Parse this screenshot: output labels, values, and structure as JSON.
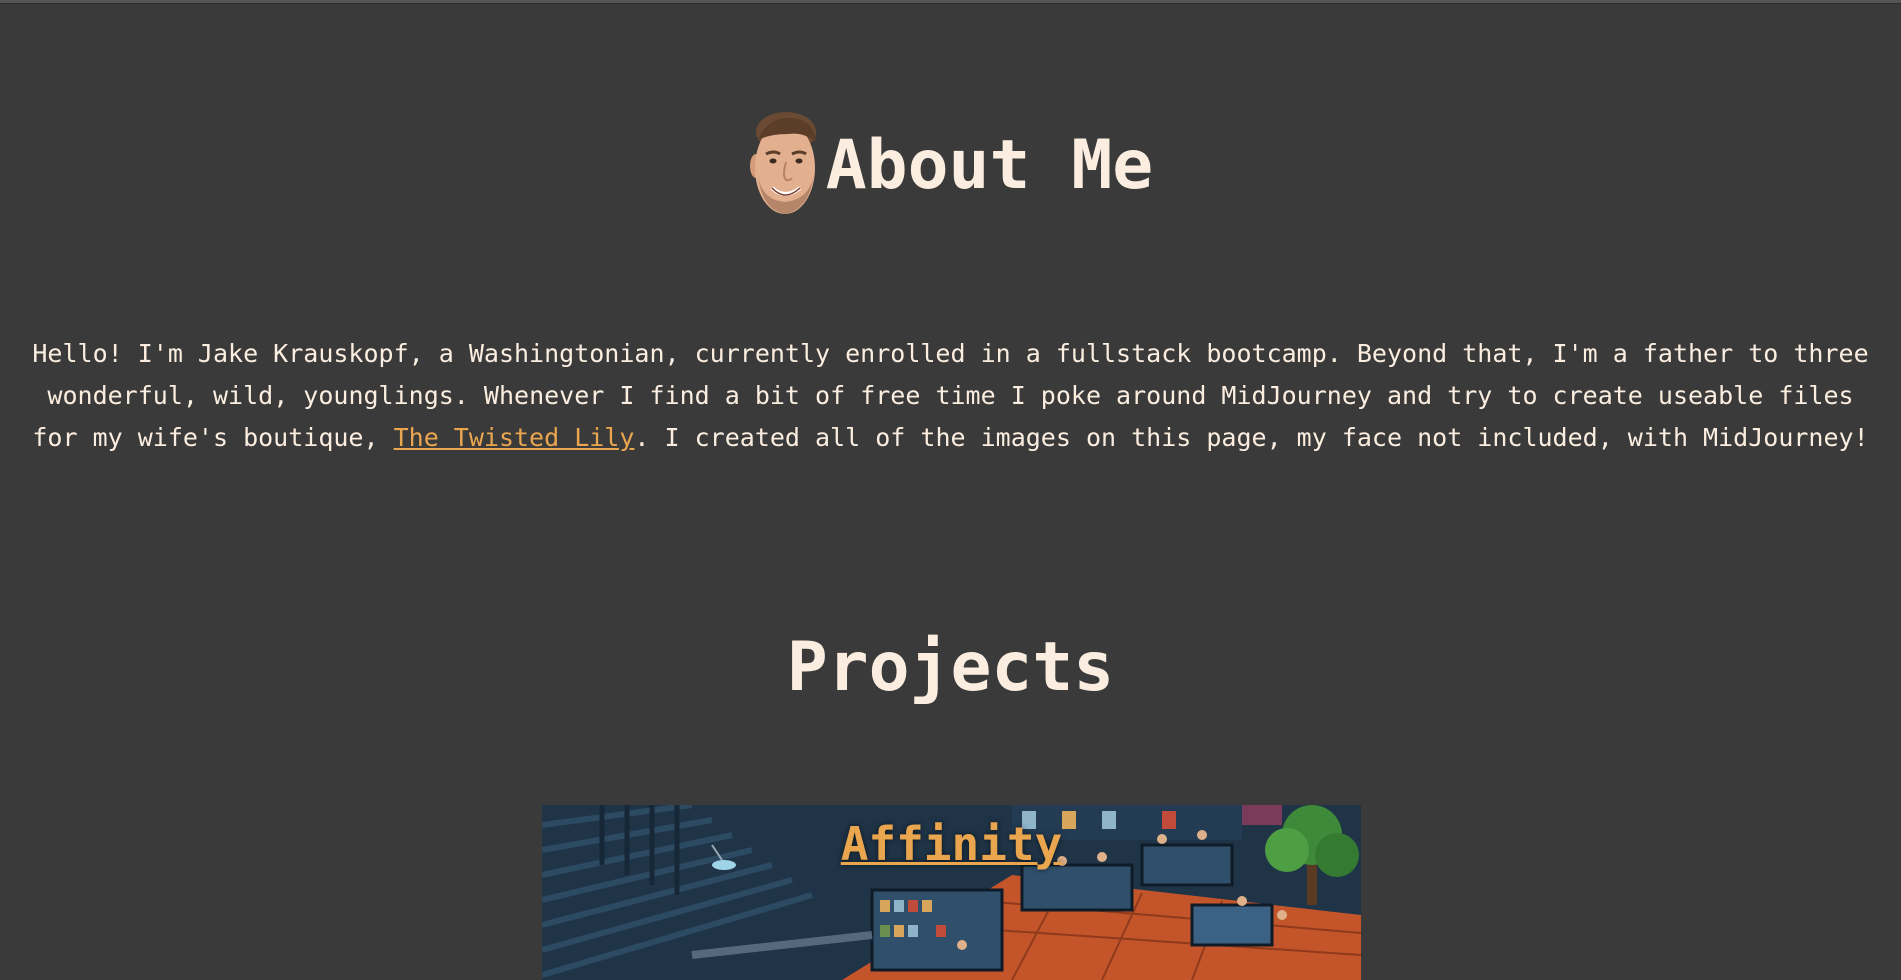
{
  "about": {
    "title": "About Me",
    "intro_before_link": "Hello! I'm Jake Krauskopf, a Washingtonian, currently enrolled in a fullstack bootcamp. Beyond that, I'm a father to three wonderful, wild, younglings. Whenever I find a bit of free time I poke around MidJourney and try to create useable files for my wife's boutique, ",
    "link_text": "The Twisted Lily",
    "intro_after_link": ". I created all of the images on this page, my face not included, with MidJourney!"
  },
  "projects": {
    "title": "Projects",
    "items": [
      {
        "name": "Affinity"
      }
    ]
  },
  "colors": {
    "background": "#3a3a3a",
    "text": "#fbeee0",
    "link": "#e9a64f"
  }
}
